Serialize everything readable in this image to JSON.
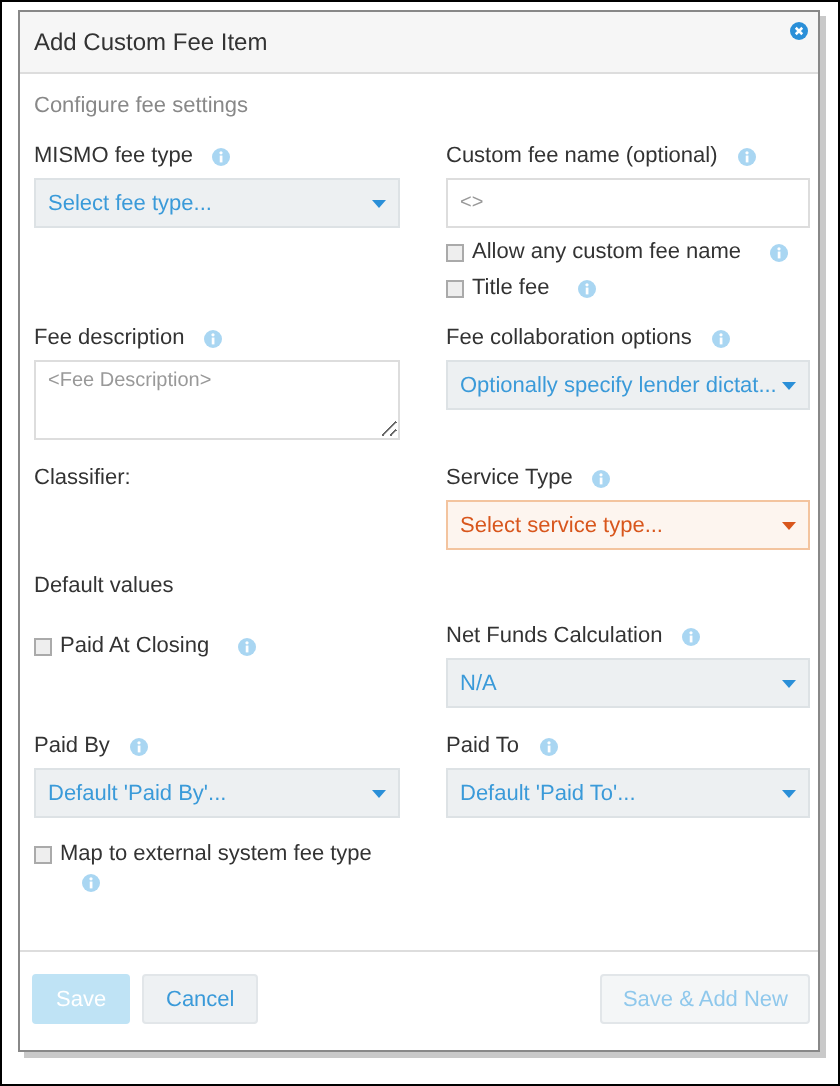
{
  "dialog": {
    "title": "Add Custom Fee Item",
    "subtitle": "Configure fee settings"
  },
  "rows": [
    {
      "left": [
        {
          "kind": "label",
          "text": "MISMO fee type",
          "info": true
        },
        {
          "kind": "select",
          "value": "Select fee type...",
          "invalid": false
        }
      ],
      "right": [
        {
          "kind": "label",
          "text": "Custom fee name (optional)",
          "info": true
        },
        {
          "kind": "input",
          "placeholder": "<>"
        },
        {
          "kind": "checkbox",
          "text": "Allow any custom fee name",
          "checked": false,
          "info": true
        },
        {
          "kind": "checkbox",
          "text": "Title fee",
          "checked": false,
          "info": true
        }
      ]
    },
    {
      "left": [
        {
          "kind": "label",
          "text": "Fee description",
          "info": true
        },
        {
          "kind": "textarea",
          "placeholder": "<Fee Description>"
        }
      ],
      "right": [
        {
          "kind": "label",
          "text": "Fee collaboration options",
          "info": true
        },
        {
          "kind": "select",
          "value": "Optionally specify lender dictat...",
          "invalid": false
        }
      ]
    },
    {
      "left": [
        {
          "kind": "label",
          "text": "Classifier:",
          "info": false
        }
      ],
      "right": [
        {
          "kind": "label",
          "text": "Service Type",
          "info": true
        },
        {
          "kind": "select",
          "value": "Select service type...",
          "invalid": true
        }
      ]
    },
    {
      "left": [
        {
          "kind": "heading",
          "text": "Default values"
        }
      ],
      "right": []
    },
    {
      "left": [
        {
          "kind": "checkbox",
          "text": "Paid At Closing",
          "checked": false,
          "info": true
        }
      ],
      "right": [
        {
          "kind": "label",
          "text": "Net Funds Calculation",
          "info": true
        },
        {
          "kind": "select",
          "value": "N/A",
          "invalid": false
        }
      ]
    },
    {
      "left": [
        {
          "kind": "label",
          "text": "Paid By",
          "info": true
        },
        {
          "kind": "select",
          "value": "Default 'Paid By'...",
          "invalid": false
        }
      ],
      "right": [
        {
          "kind": "label",
          "text": "Paid To",
          "info": true
        },
        {
          "kind": "select",
          "value": "Default 'Paid To'...",
          "invalid": false
        }
      ]
    },
    {
      "left": [
        {
          "kind": "checkbox",
          "text": "Map to external system fee type",
          "checked": false,
          "info": true,
          "info_below": true
        }
      ],
      "right": []
    }
  ],
  "buttons_left": [
    {
      "label": "Save",
      "kind": "primary",
      "disabled": true
    },
    {
      "label": "Cancel",
      "kind": "default",
      "disabled": false
    }
  ],
  "buttons_right": [
    {
      "label": "Save & Add New",
      "kind": "default",
      "disabled": true
    }
  ]
}
